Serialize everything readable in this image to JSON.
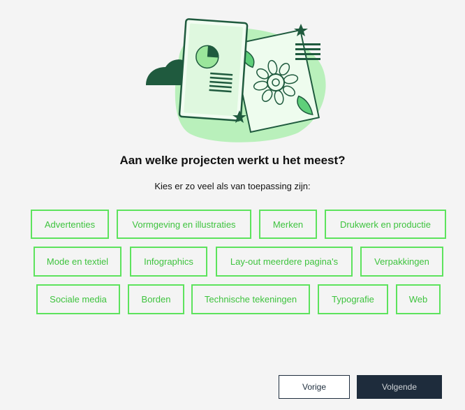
{
  "question": {
    "title": "Aan welke projecten werkt u het meest?",
    "subtitle": "Kies er zo veel als van toepassing zijn:"
  },
  "options": [
    "Advertenties",
    "Vormgeving en illustraties",
    "Merken",
    "Drukwerk en productie",
    "Mode en textiel",
    "Infographics",
    "Lay-out meerdere pagina's",
    "Verpakkingen",
    "Sociale media",
    "Borden",
    "Technische tekeningen",
    "Typografie",
    "Web"
  ],
  "nav": {
    "prev_label": "Vorige",
    "next_label": "Volgende"
  },
  "colors": {
    "accent": "#5de35d",
    "primary_button": "#1e2c3c",
    "illustration_dark": "#1f5a3e",
    "illustration_light": "#b9f0bb"
  }
}
